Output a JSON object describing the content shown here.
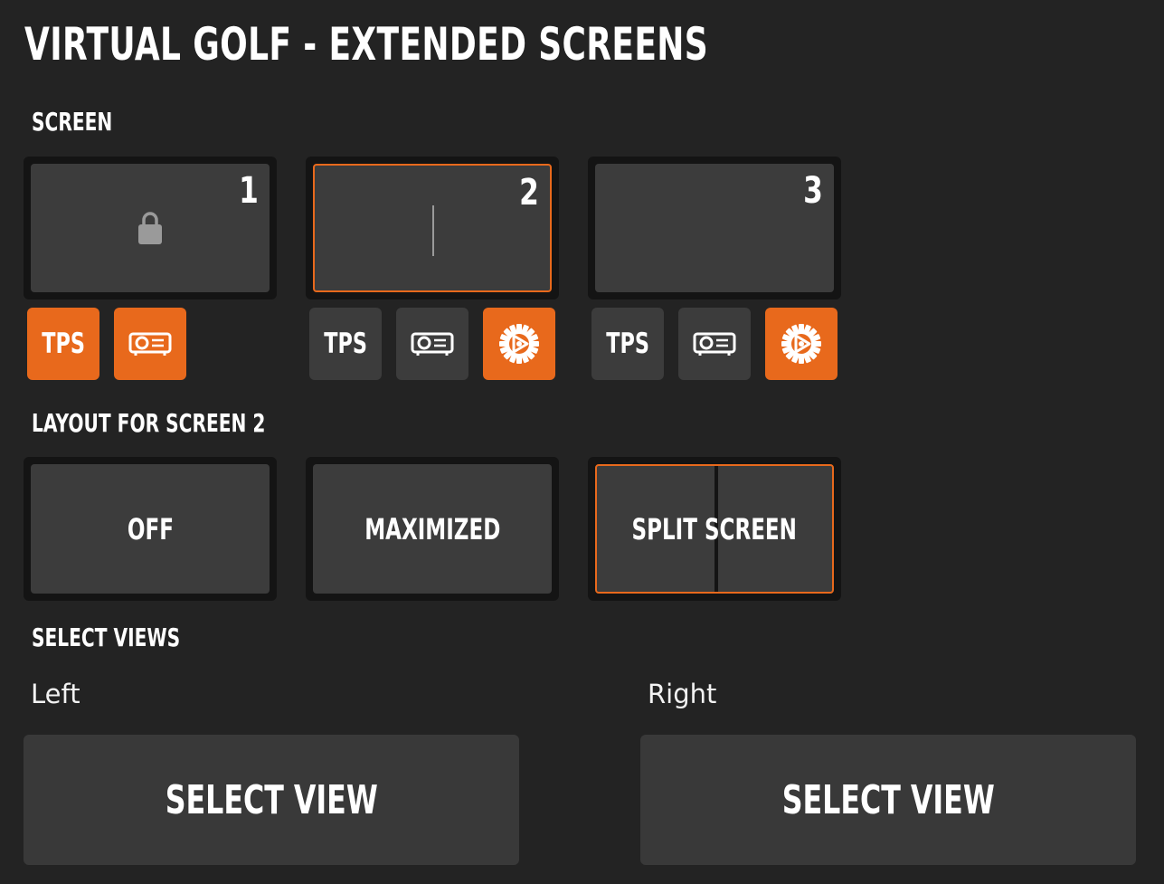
{
  "title": "VIRTUAL GOLF - EXTENDED SCREENS",
  "colors": {
    "background": "#232323",
    "card": "#3c3c3c",
    "card_frame": "#141414",
    "accent": "#e8691c"
  },
  "screen_section": {
    "label": "SCREEN",
    "screens": [
      {
        "number": "1",
        "locked": true,
        "selected": false,
        "tps_label": "TPS",
        "tps_on": true,
        "projector_on": true,
        "has_settings": false,
        "settings_on": false
      },
      {
        "number": "2",
        "locked": false,
        "selected": true,
        "tps_label": "TPS",
        "tps_on": false,
        "projector_on": false,
        "has_settings": true,
        "settings_on": true
      },
      {
        "number": "3",
        "locked": false,
        "selected": false,
        "tps_label": "TPS",
        "tps_on": false,
        "projector_on": false,
        "has_settings": true,
        "settings_on": true
      }
    ]
  },
  "layout_section": {
    "label": "LAYOUT FOR SCREEN 2",
    "options": [
      {
        "label": "OFF",
        "selected": false
      },
      {
        "label": "MAXIMIZED",
        "selected": false
      },
      {
        "label": "SPLIT SCREEN",
        "selected": true
      }
    ]
  },
  "views_section": {
    "label": "SELECT VIEWS",
    "left": {
      "label": "Left",
      "button": "SELECT VIEW"
    },
    "right": {
      "label": "Right",
      "button": "SELECT VIEW"
    }
  }
}
